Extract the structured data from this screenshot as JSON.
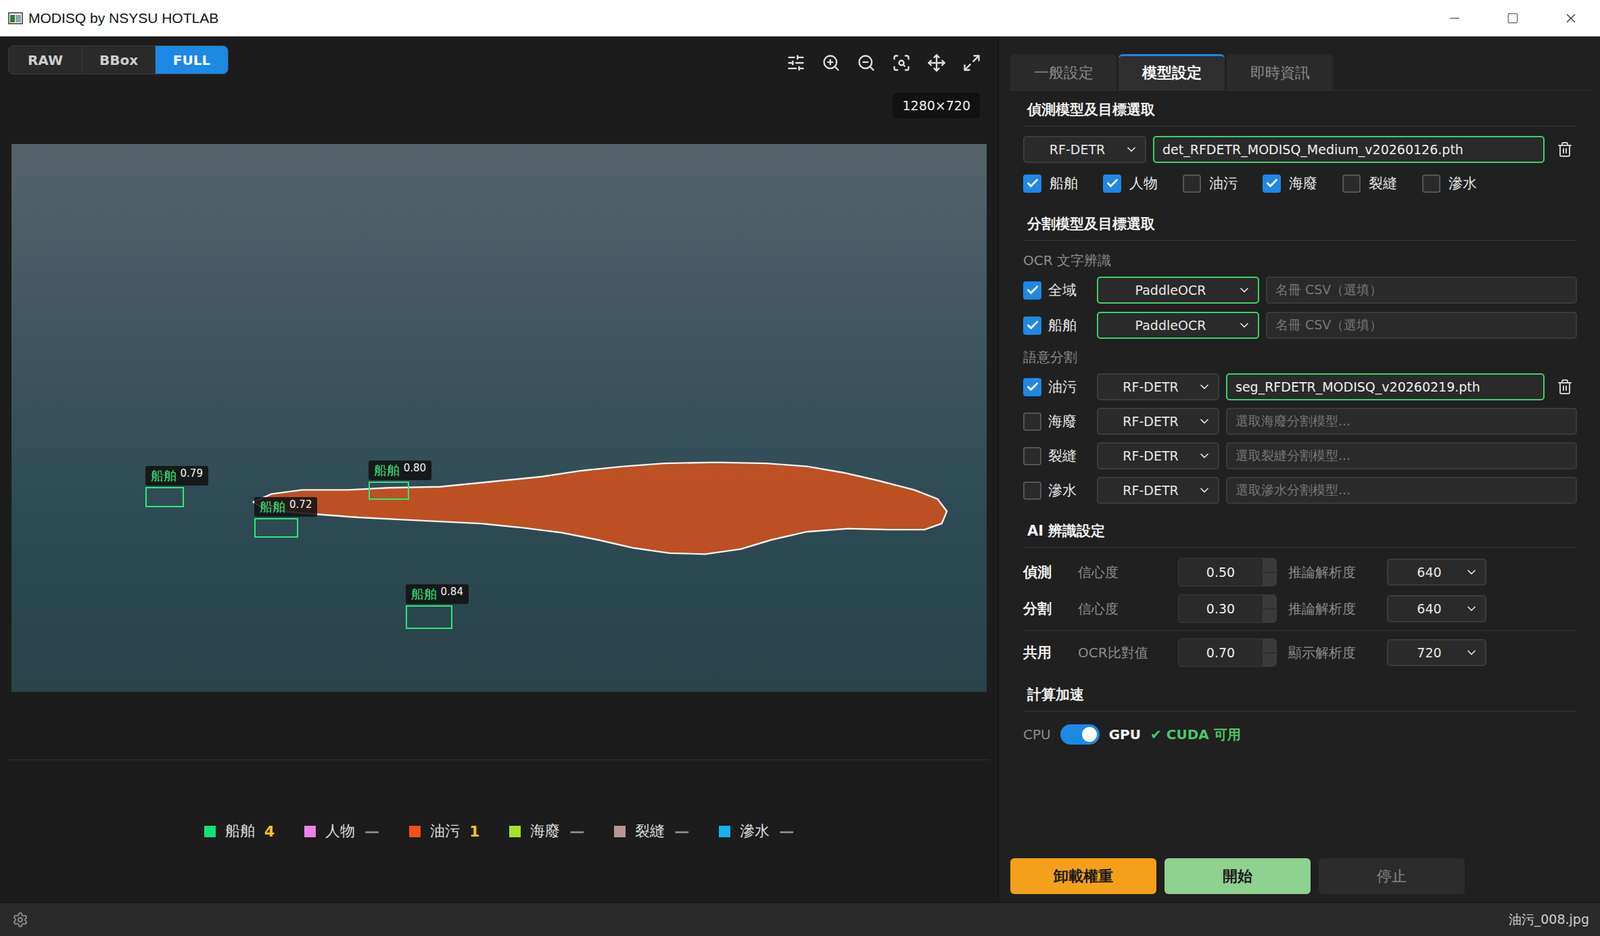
{
  "window": {
    "title": "MODISQ by NSYSU HOTLAB"
  },
  "view_modes": [
    {
      "label": "RAW",
      "selected": false
    },
    {
      "label": "BBox",
      "selected": false
    },
    {
      "label": "FULL",
      "selected": true
    }
  ],
  "resolution_badge": "1280×720",
  "detections": [
    {
      "label": "船舶",
      "score": "0.79"
    },
    {
      "label": "船舶",
      "score": "0.80"
    },
    {
      "label": "船舶",
      "score": "0.72"
    },
    {
      "label": "船舶",
      "score": "0.84"
    }
  ],
  "legend": [
    {
      "name": "船舶",
      "count": "4",
      "detected": true,
      "color": "#12e07a"
    },
    {
      "name": "人物",
      "count": "—",
      "detected": false,
      "color": "#e884e8"
    },
    {
      "name": "油污",
      "count": "1",
      "detected": true,
      "color": "#f0501c"
    },
    {
      "name": "海廢",
      "count": "—",
      "detected": false,
      "color": "#a6e22e"
    },
    {
      "name": "裂縫",
      "count": "—",
      "detected": false,
      "color": "#b89494"
    },
    {
      "name": "滲水",
      "count": "—",
      "detected": false,
      "color": "#14b4ec"
    }
  ],
  "tabs": [
    {
      "label": "一般設定",
      "selected": false
    },
    {
      "label": "模型設定",
      "selected": true
    },
    {
      "label": "即時資訊",
      "selected": false
    }
  ],
  "detection_section": {
    "title": "偵測模型及目標選取",
    "model_type": "RF-DETR",
    "weight_file": "det_RFDETR_MODISQ_Medium_v20260126.pth",
    "loaded": true,
    "targets": [
      {
        "label": "船舶",
        "checked": true
      },
      {
        "label": "人物",
        "checked": true
      },
      {
        "label": "油污",
        "checked": false
      },
      {
        "label": "海廢",
        "checked": true
      },
      {
        "label": "裂縫",
        "checked": false
      },
      {
        "label": "滲水",
        "checked": false
      }
    ]
  },
  "segmentation_section": {
    "title": "分割模型及目標選取",
    "ocr": {
      "title": "OCR 文字辨識",
      "rows": [
        {
          "label": "全域",
          "checked": true,
          "engine": "PaddleOCR",
          "csv_placeholder": "名冊 CSV（選填）"
        },
        {
          "label": "船舶",
          "checked": true,
          "engine": "PaddleOCR",
          "csv_placeholder": "名冊 CSV（選填）"
        }
      ]
    },
    "semantic": {
      "title": "語意分割",
      "rows": [
        {
          "label": "油污",
          "checked": true,
          "model_type": "RF-DETR",
          "loaded": true,
          "weight_file": "seg_RFDETR_MODISQ_v20260219.pth"
        },
        {
          "label": "海廢",
          "checked": false,
          "model_type": "RF-DETR",
          "loaded": false,
          "placeholder": "選取海廢分割模型..."
        },
        {
          "label": "裂縫",
          "checked": false,
          "model_type": "RF-DETR",
          "loaded": false,
          "placeholder": "選取裂縫分割模型..."
        },
        {
          "label": "滲水",
          "checked": false,
          "model_type": "RF-DETR",
          "loaded": false,
          "placeholder": "選取滲水分割模型..."
        }
      ]
    }
  },
  "ai_settings": {
    "title": "AI 辨識設定",
    "rows": [
      {
        "group": "偵測",
        "label": "信心度",
        "value": "0.50",
        "select_label": "推論解析度",
        "select_value": "640"
      },
      {
        "group": "分割",
        "label": "信心度",
        "value": "0.30",
        "select_label": "推論解析度",
        "select_value": "640"
      },
      {
        "group": "共用",
        "label": "OCR比對值",
        "value": "0.70",
        "select_label": "顯示解析度",
        "select_value": "720"
      }
    ]
  },
  "acceleration": {
    "title": "計算加速",
    "off_label": "CPU",
    "on_label": "GPU",
    "gpu_on": true,
    "status": "✔ CUDA 可用"
  },
  "buttons": [
    {
      "label": "卸載權重",
      "kind": "warning",
      "disabled": false
    },
    {
      "label": "開始",
      "kind": "primary",
      "disabled": false
    },
    {
      "label": "停止",
      "kind": "neutral",
      "disabled": true
    }
  ],
  "status_bar": {
    "file": "油污_008.jpg"
  }
}
